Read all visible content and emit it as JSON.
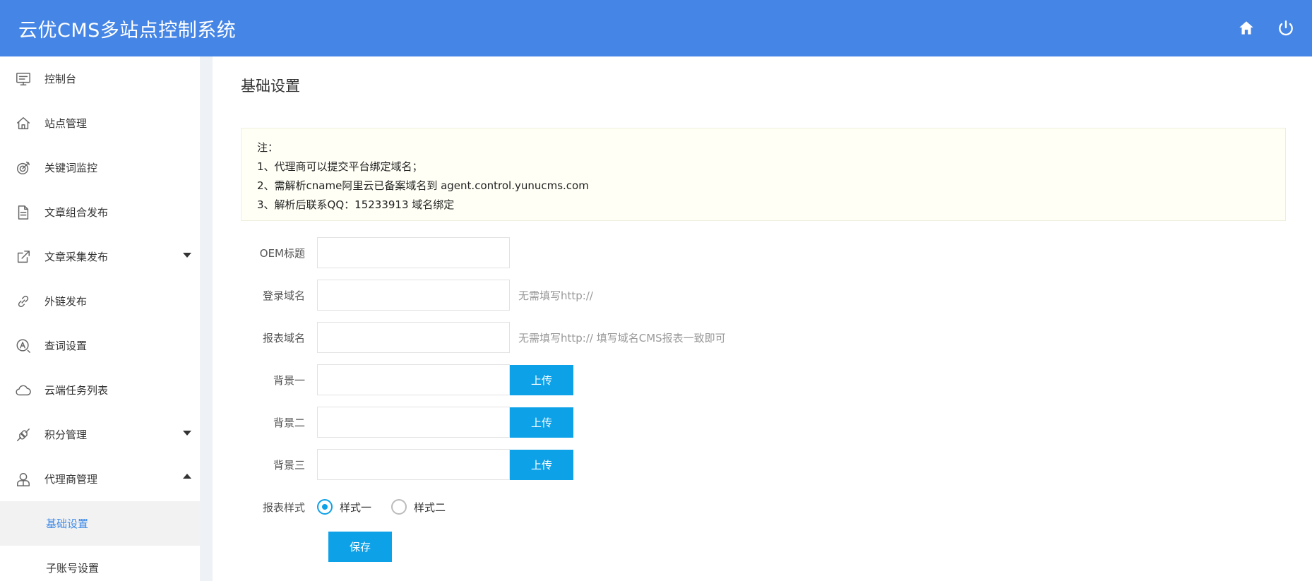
{
  "header": {
    "title": "云优CMS多站点控制系统",
    "icons": [
      "home-icon",
      "power-icon"
    ],
    "bg_color": "#4585e5"
  },
  "sidebar": {
    "items": [
      {
        "label": "控制台",
        "icon": "monitor-icon"
      },
      {
        "label": "站点管理",
        "icon": "home-icon"
      },
      {
        "label": "关键词监控",
        "icon": "target-icon"
      },
      {
        "label": "文章组合发布",
        "icon": "document-icon"
      },
      {
        "label": "文章采集发布",
        "icon": "external-link-icon",
        "arrow": "down"
      },
      {
        "label": "外链发布",
        "icon": "link-icon"
      },
      {
        "label": "查词设置",
        "icon": "search-a-icon"
      },
      {
        "label": "云端任务列表",
        "icon": "cloud-icon"
      },
      {
        "label": "积分管理",
        "icon": "plug-icon",
        "arrow": "down"
      },
      {
        "label": "代理商管理",
        "icon": "user-icon",
        "arrow": "up"
      }
    ],
    "sub_items": [
      {
        "label": "基础设置",
        "active": true
      },
      {
        "label": "子账号设置",
        "active": false
      }
    ]
  },
  "main": {
    "title": "基础设置",
    "notice": {
      "lines": [
        "注：",
        "1、代理商可以提交平台绑定域名；",
        "2、需解析cname阿里云已备案域名到 agent.control.yunucms.com",
        "3、解析后联系QQ：15233913 域名绑定"
      ]
    },
    "form": {
      "oem_title_label": "OEM标题",
      "oem_title_value": "",
      "login_domain_label": "登录域名",
      "login_domain_value": "",
      "login_domain_hint": "无需填写http://",
      "report_domain_label": "报表域名",
      "report_domain_value": "",
      "report_domain_hint": "无需填写http:// 填写域名CMS报表一致即可",
      "bg1_label": "背景一",
      "bg2_label": "背景二",
      "bg3_label": "背景三",
      "upload_label": "上传",
      "style_label": "报表样式",
      "style_options": [
        "样式一",
        "样式二"
      ],
      "style_selected": "样式一",
      "save_label": "保存"
    },
    "accent_color": "#0da1e8"
  }
}
